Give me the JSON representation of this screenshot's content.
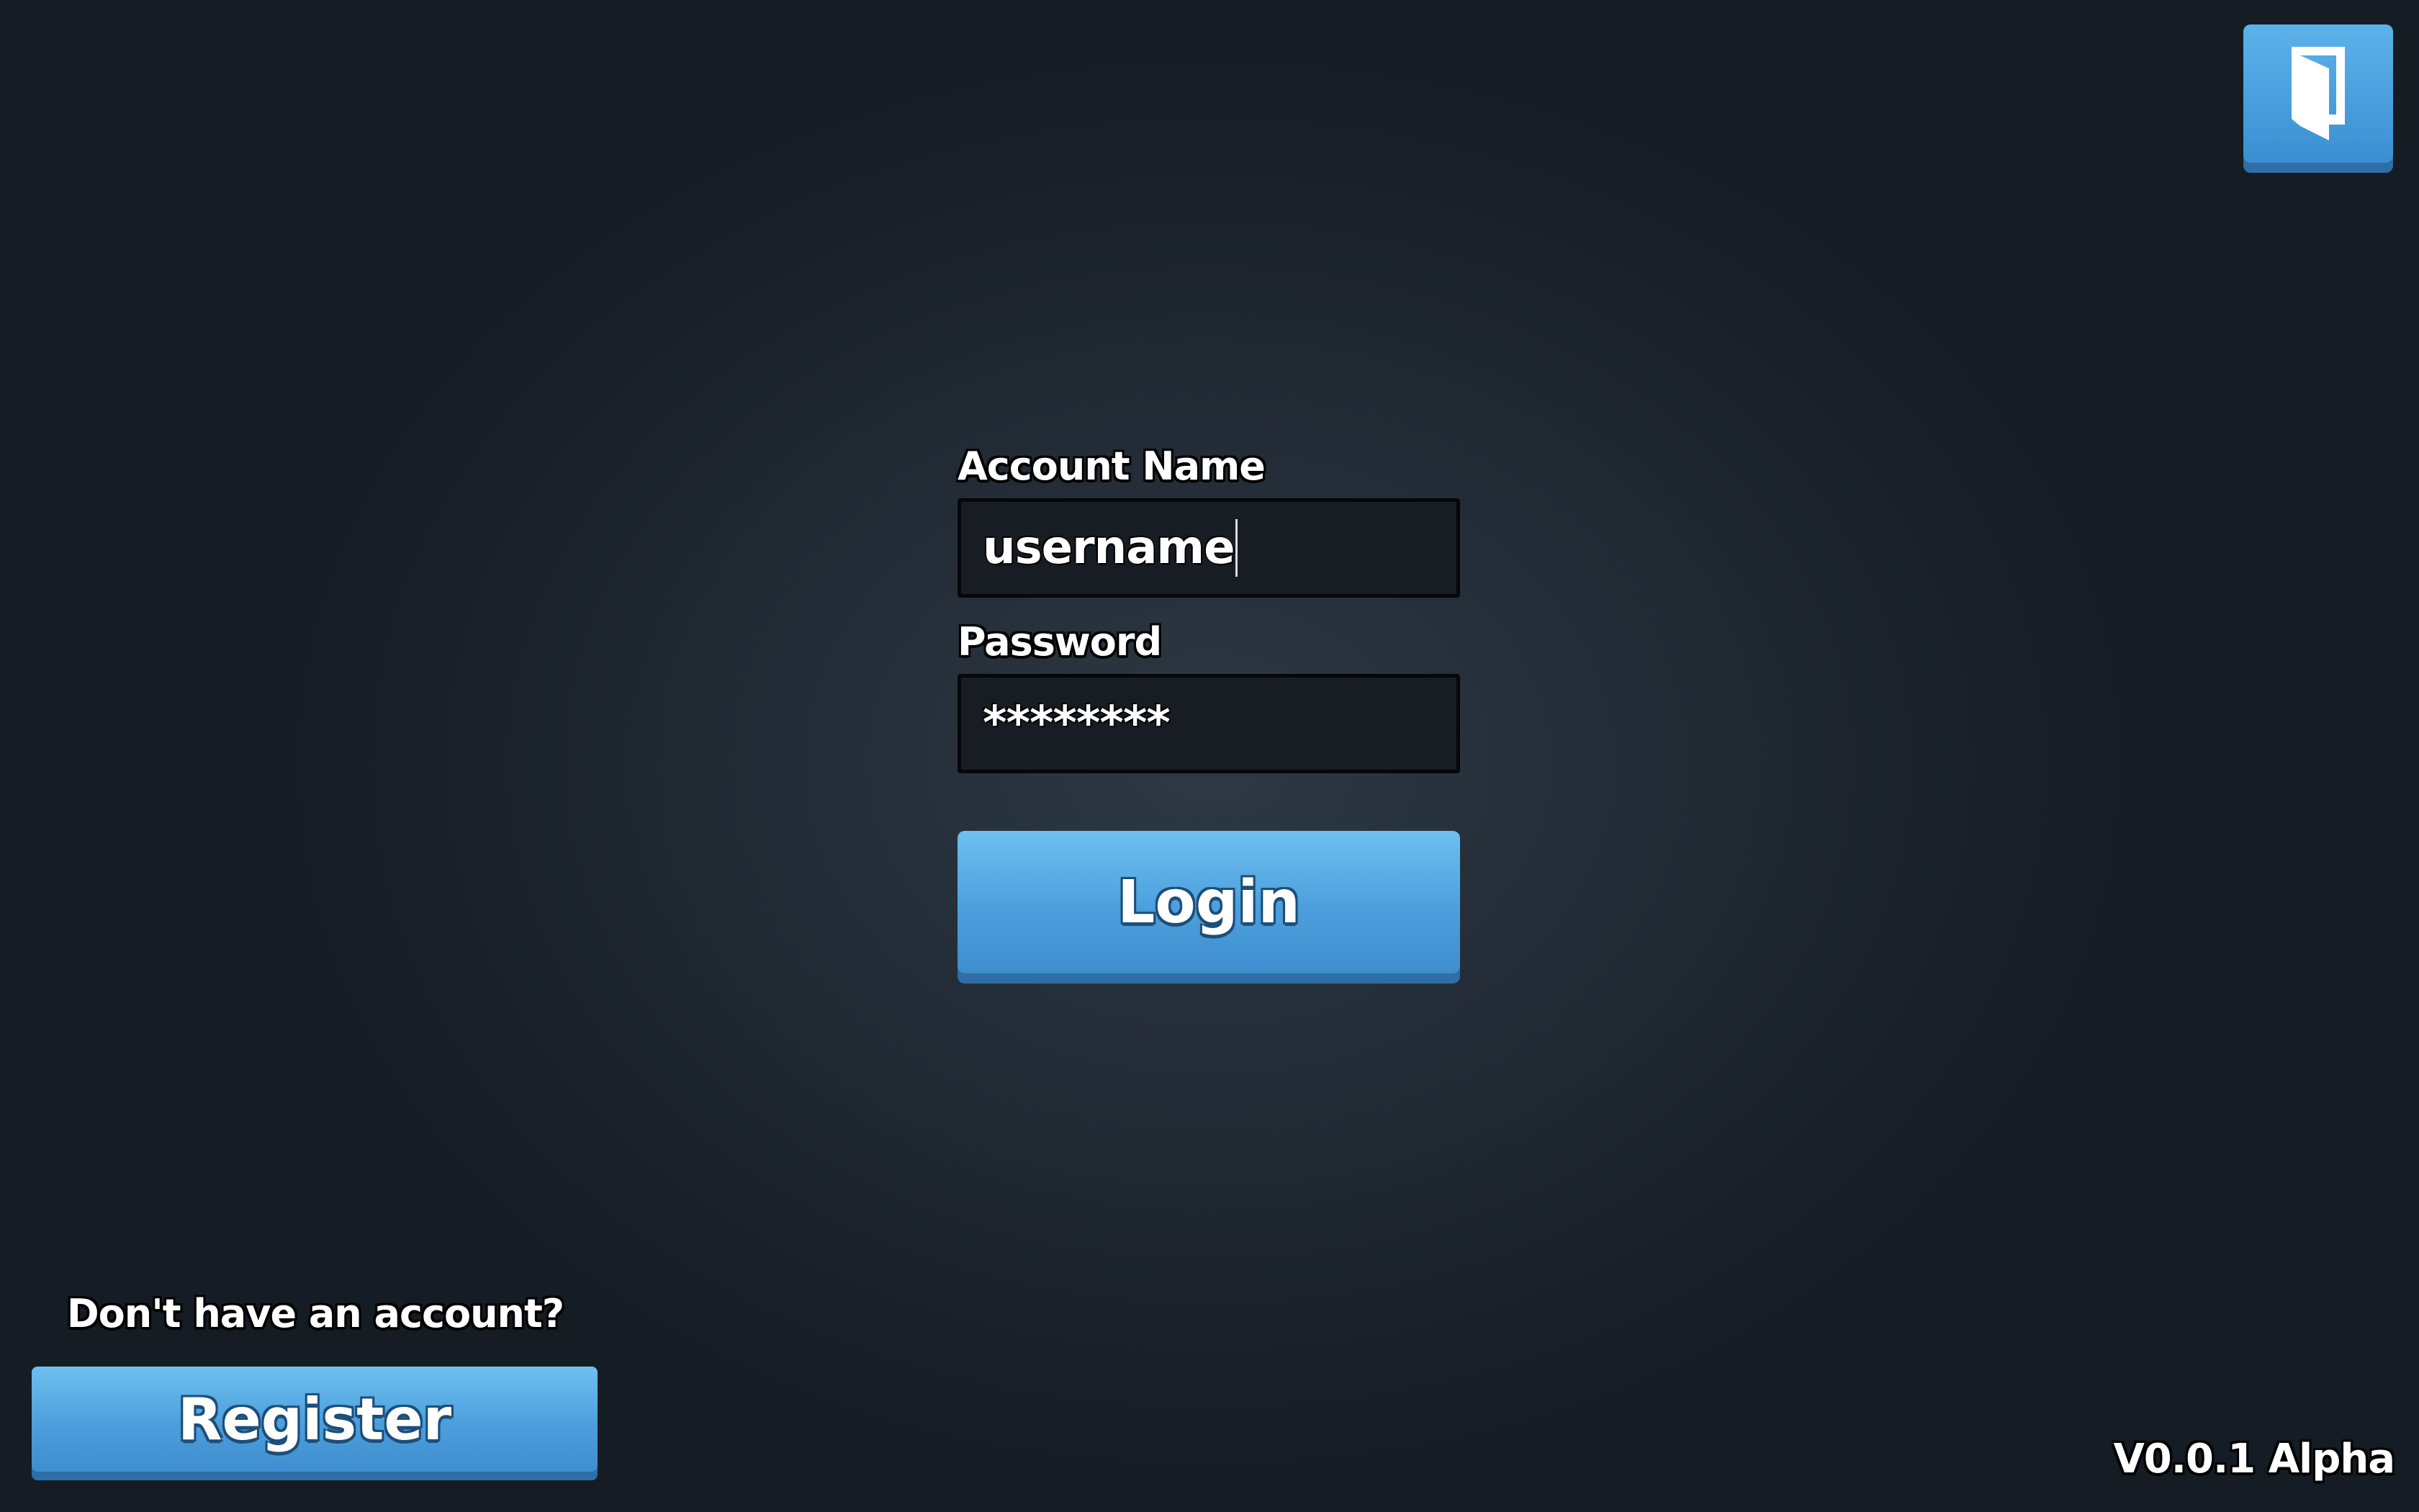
{
  "header": {
    "exit_icon": "exit-door-icon"
  },
  "login_form": {
    "account_label": "Account Name",
    "account_value": "username",
    "password_label": "Password",
    "password_value": "********",
    "login_label": "Login"
  },
  "register": {
    "prompt": "Don't have an account?",
    "button_label": "Register"
  },
  "footer": {
    "version": "V0.0.1 Alpha"
  },
  "colors": {
    "accent": "#4c9fdc",
    "accent_shadow": "#2f6ea6",
    "background": "#1e262f",
    "field_background": "#181d23"
  }
}
